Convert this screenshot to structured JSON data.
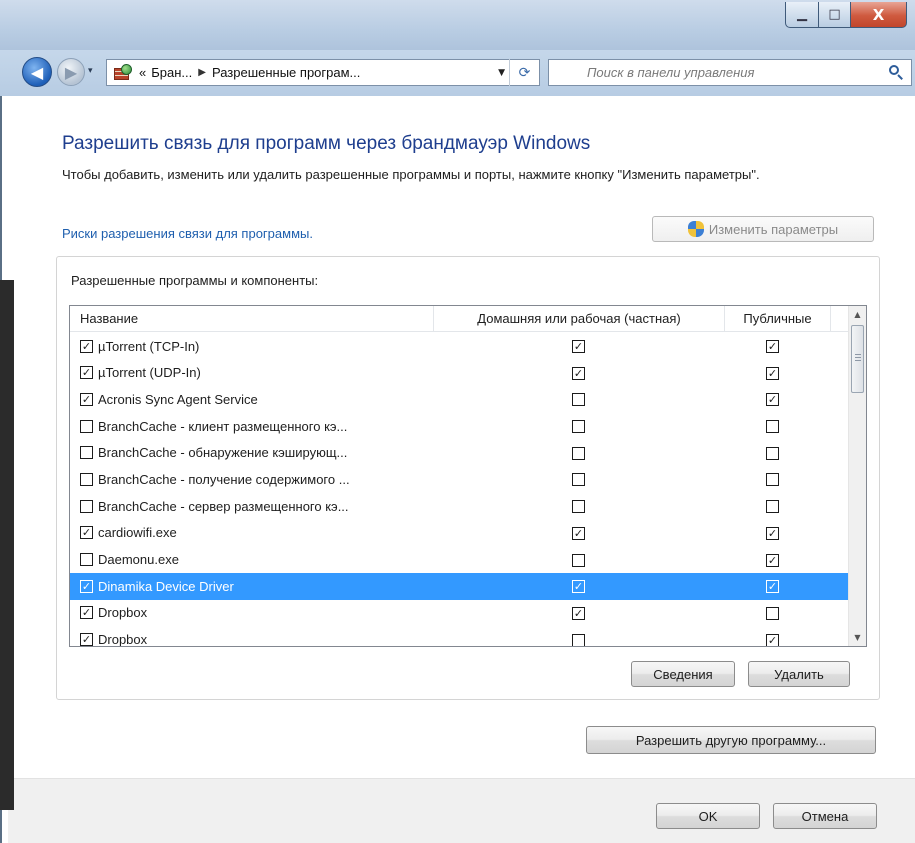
{
  "window": {
    "caption_buttons": {
      "minimize": "▁",
      "maximize": "□",
      "close": "X"
    }
  },
  "nav": {
    "back_icon": "back-arrow-icon",
    "forward_icon": "forward-arrow-icon",
    "history_icon": "▾",
    "address": {
      "icon": "firewall-icon",
      "crumb_prefix": "«",
      "crumb_1": "Бран...",
      "crumb_sep": "▶",
      "crumb_2": "Разрешенные програм...",
      "dropdown": "▼",
      "refresh": "⟳"
    },
    "search": {
      "placeholder": "Поиск в панели управления",
      "icon": "search-icon"
    }
  },
  "page": {
    "title": "Разрешить связь для программ через брандмауэр Windows",
    "description": "Чтобы добавить, изменить или удалить разрешенные программы и порты, нажмите кнопку \"Изменить параметры\".",
    "risk_link": "Риски разрешения связи для программы.",
    "change_settings_label": "Изменить параметры"
  },
  "programs": {
    "group_label": "Разрешенные программы и компоненты:",
    "columns": {
      "name": "Название",
      "private": "Домашняя или рабочая (частная)",
      "public": "Публичные"
    },
    "rows": [
      {
        "name": "µTorrent (TCP-In)",
        "enabled": true,
        "private": true,
        "public": true,
        "selected": false
      },
      {
        "name": "µTorrent (UDP-In)",
        "enabled": true,
        "private": true,
        "public": true,
        "selected": false
      },
      {
        "name": "Acronis Sync Agent Service",
        "enabled": true,
        "private": false,
        "public": true,
        "selected": false
      },
      {
        "name": "BranchCache - клиент размещенного кэ...",
        "enabled": false,
        "private": false,
        "public": false,
        "selected": false
      },
      {
        "name": "BranchCache - обнаружение кэширующ...",
        "enabled": false,
        "private": false,
        "public": false,
        "selected": false
      },
      {
        "name": "BranchCache - получение содержимого ...",
        "enabled": false,
        "private": false,
        "public": false,
        "selected": false
      },
      {
        "name": "BranchCache - сервер размещенного кэ...",
        "enabled": false,
        "private": false,
        "public": false,
        "selected": false
      },
      {
        "name": "cardiowifi.exe",
        "enabled": true,
        "private": true,
        "public": true,
        "selected": false
      },
      {
        "name": "Daemonu.exe",
        "enabled": false,
        "private": false,
        "public": true,
        "selected": false
      },
      {
        "name": "Dinamika Device Driver",
        "enabled": true,
        "private": true,
        "public": true,
        "selected": true
      },
      {
        "name": "Dropbox",
        "enabled": true,
        "private": true,
        "public": false,
        "selected": false
      },
      {
        "name": "Dropbox",
        "enabled": true,
        "private": false,
        "public": true,
        "selected": false
      }
    ],
    "details_label": "Сведения",
    "delete_label": "Удалить",
    "scroll_up": "▲",
    "scroll_down": "▼"
  },
  "allow_other_label": "Разрешить другую программу...",
  "footer": {
    "ok_label": "OK",
    "cancel_label": "Отмена"
  },
  "colors": {
    "title": "#1e3e8e",
    "link": "#1f5fae",
    "selection": "#3399ff",
    "close_button": "#c1452b"
  }
}
